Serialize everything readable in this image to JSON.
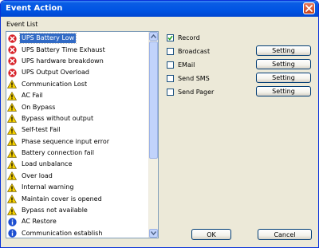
{
  "window": {
    "title": "Event Action"
  },
  "event_list": {
    "label": "Event List",
    "items": [
      {
        "label": "UPS Battery Low",
        "icon": "error-icon",
        "selected": true
      },
      {
        "label": "UPS Battery Time Exhaust",
        "icon": "error-icon"
      },
      {
        "label": "UPS hardware breakdown",
        "icon": "error-icon"
      },
      {
        "label": "UPS Output Overload",
        "icon": "error-icon"
      },
      {
        "label": "Communication Lost",
        "icon": "warning-icon"
      },
      {
        "label": "AC Fail",
        "icon": "warning-icon"
      },
      {
        "label": "On Bypass",
        "icon": "warning-icon"
      },
      {
        "label": "Bypass without output",
        "icon": "warning-icon"
      },
      {
        "label": "Self-test Fail",
        "icon": "warning-icon"
      },
      {
        "label": "Phase sequence input error",
        "icon": "warning-icon"
      },
      {
        "label": "Battery connection fail",
        "icon": "warning-icon"
      },
      {
        "label": "Load unbalance",
        "icon": "warning-icon"
      },
      {
        "label": "Over load",
        "icon": "warning-icon"
      },
      {
        "label": "Internal warning",
        "icon": "warning-icon"
      },
      {
        "label": "Maintain cover is opened",
        "icon": "warning-icon"
      },
      {
        "label": "Bypass not available",
        "icon": "warning-icon"
      },
      {
        "label": "AC Restore",
        "icon": "info-icon"
      },
      {
        "label": "Communication establish",
        "icon": "info-icon"
      }
    ]
  },
  "actions": {
    "record": {
      "label": "Record",
      "checked": true
    },
    "broadcast": {
      "label": "Broadcast",
      "checked": false,
      "setting_label": "Setting"
    },
    "email": {
      "label": "EMail",
      "checked": false,
      "setting_label": "Setting"
    },
    "sms": {
      "label": "Send SMS",
      "checked": false,
      "setting_label": "Setting"
    },
    "pager": {
      "label": "Send Pager",
      "checked": false,
      "setting_label": "Setting"
    }
  },
  "footer": {
    "ok_label": "OK",
    "cancel_label": "Cancel"
  },
  "colors": {
    "titlebar": "#0054e3",
    "selection": "#316ac5",
    "error": "#d8242b",
    "warning": "#f5d000",
    "info": "#1d4fd1"
  }
}
